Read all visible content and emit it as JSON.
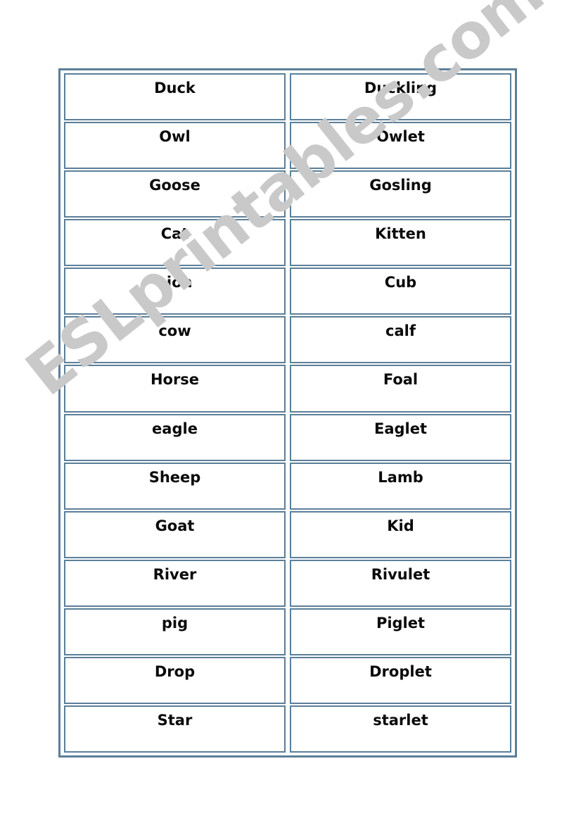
{
  "page": {
    "background_color": "#ffffff",
    "border_color": "#5b7f99",
    "text_color": "#0a0a0a"
  },
  "watermark": {
    "text": "ESLprintables.com",
    "color": "#c9c9c9"
  },
  "table": {
    "columns": 2,
    "row_count": 14,
    "rows": [
      {
        "left": "Duck",
        "right": "Duckling"
      },
      {
        "left": "Owl",
        "right": "Owlet"
      },
      {
        "left": "Goose",
        "right": "Gosling"
      },
      {
        "left": "Cat",
        "right": "Kitten"
      },
      {
        "left": "Lion",
        "right": "Cub"
      },
      {
        "left": "cow",
        "right": "calf"
      },
      {
        "left": "Horse",
        "right": "Foal"
      },
      {
        "left": "eagle",
        "right": "Eaglet"
      },
      {
        "left": "Sheep",
        "right": "Lamb"
      },
      {
        "left": "Goat",
        "right": "Kid"
      },
      {
        "left": "River",
        "right": "Rivulet"
      },
      {
        "left": "pig",
        "right": "Piglet"
      },
      {
        "left": "Drop",
        "right": "Droplet"
      },
      {
        "left": "Star",
        "right": "starlet"
      }
    ]
  }
}
